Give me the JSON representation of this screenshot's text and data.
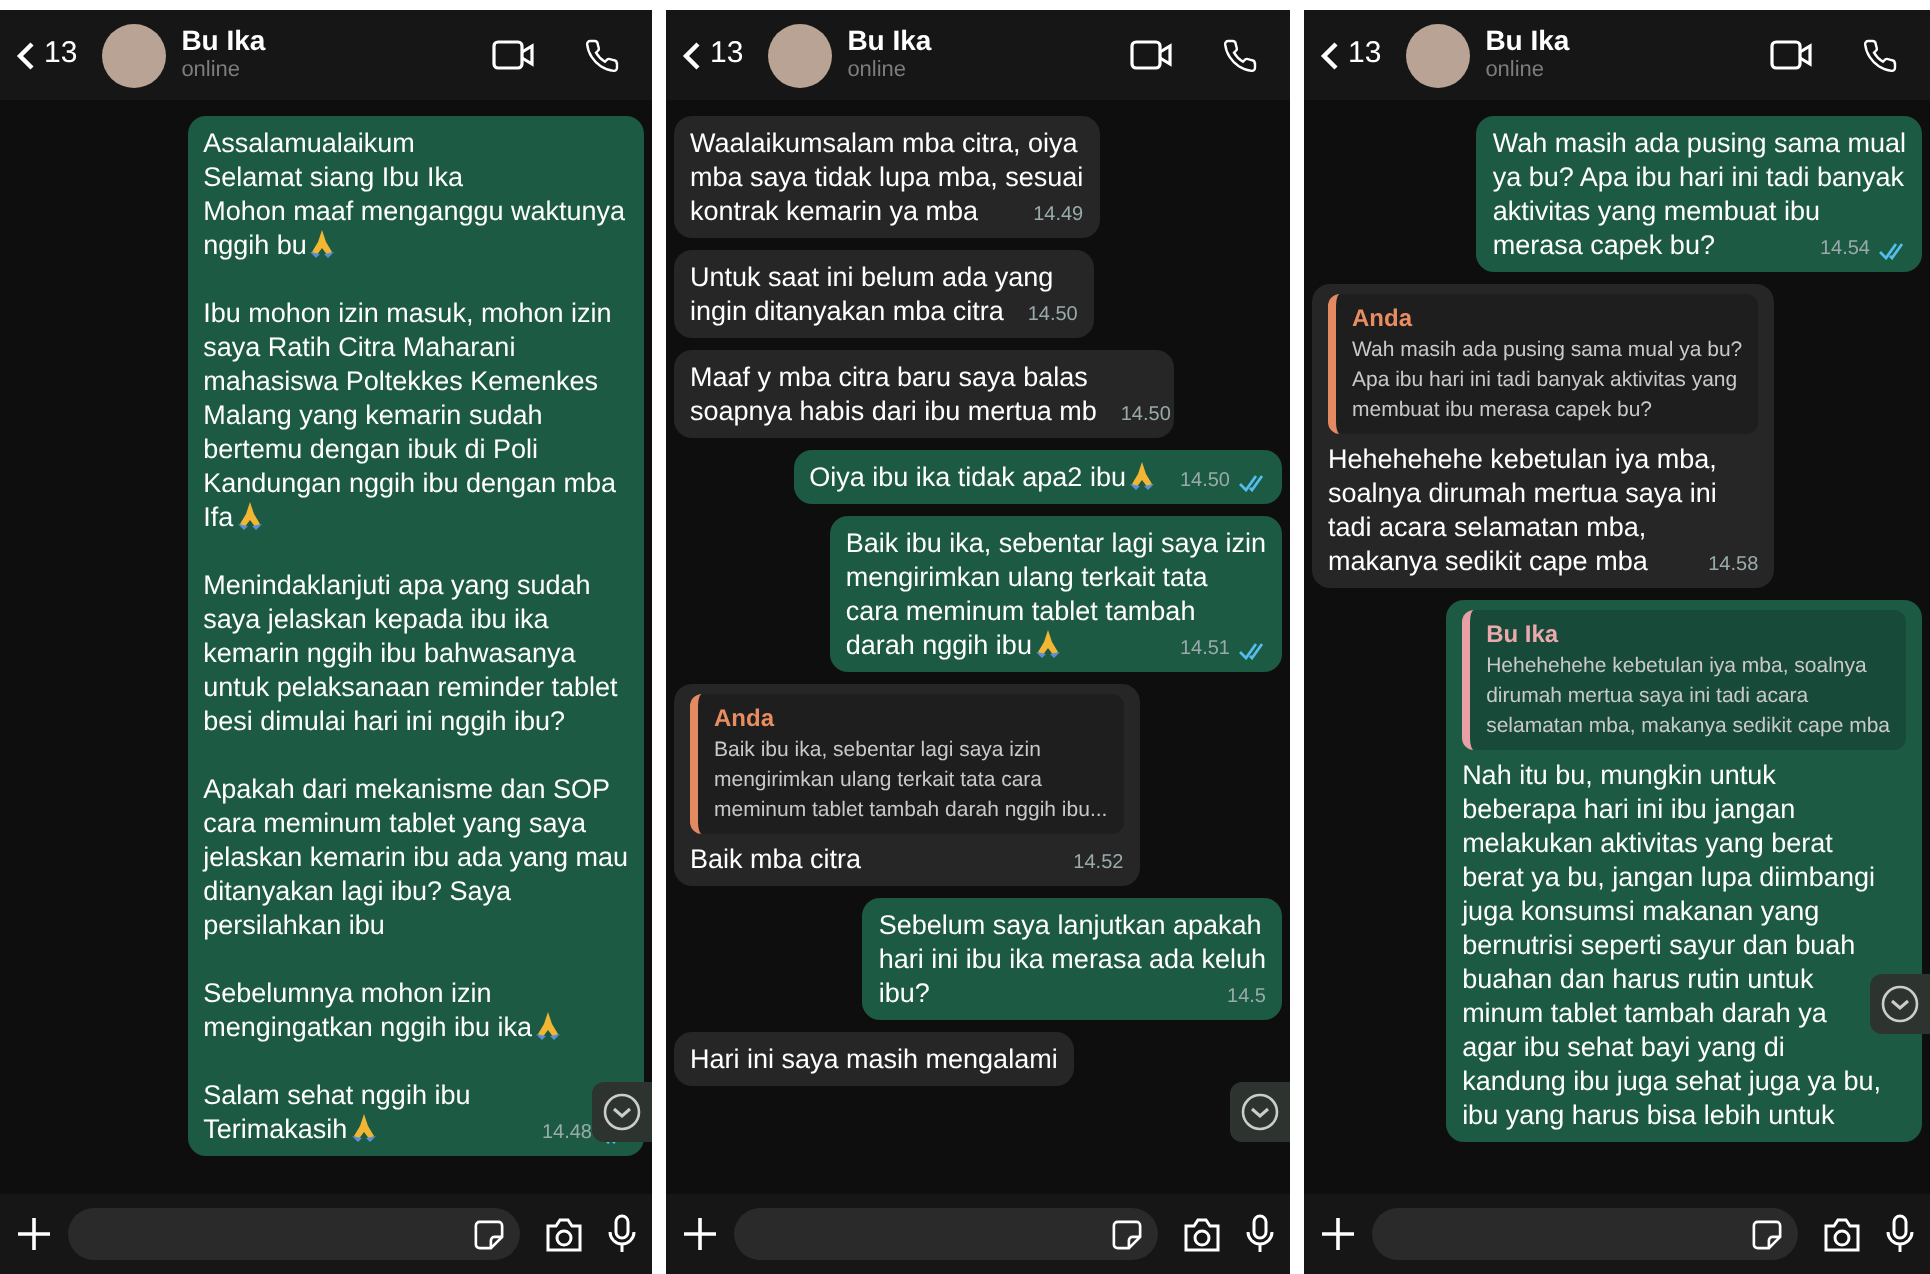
{
  "panels": [
    {
      "header": {
        "back_count": "13",
        "name": "Bu Ika",
        "status": "online"
      },
      "messages": [
        {
          "kind": "outgoing",
          "paragraphs": [
            [
              {
                "text": "Assalamualaikum"
              },
              {
                "text": "Selamat siang Ibu Ika"
              },
              {
                "text": "Mohon maaf menganggu waktunya"
              },
              {
                "text": "nggih bu",
                "pray": true
              }
            ],
            [
              {
                "text": "Ibu mohon izin masuk, mohon izin"
              },
              {
                "text": "saya Ratih Citra Maharani"
              },
              {
                "text": "mahasiswa Poltekkes Kemenkes"
              },
              {
                "text": "Malang yang kemarin sudah"
              },
              {
                "text": "bertemu dengan ibuk di Poli"
              },
              {
                "text": "Kandungan nggih ibu dengan mba"
              },
              {
                "text": "Ifa",
                "pray": true
              }
            ],
            [
              {
                "text": "Menindaklanjuti apa yang sudah"
              },
              {
                "text": "saya jelaskan kepada ibu ika"
              },
              {
                "text": "kemarin nggih ibu bahwasanya"
              },
              {
                "text": "untuk pelaksanaan reminder tablet"
              },
              {
                "text": "besi dimulai hari ini nggih ibu?"
              }
            ],
            [
              {
                "text": "Apakah dari mekanisme dan SOP"
              },
              {
                "text": "cara meminum tablet yang saya"
              },
              {
                "text": "jelaskan kemarin ibu ada yang mau"
              },
              {
                "text": "ditanyakan lagi ibu? Saya"
              },
              {
                "text": "persilahkan ibu"
              }
            ],
            [
              {
                "text": "Sebelumnya mohon izin"
              },
              {
                "text": "mengingatkan nggih ibu ika",
                "pray": true
              }
            ],
            [
              {
                "text": "Salam sehat nggih ibu"
              },
              {
                "text": "Terimakasih",
                "pray": true
              }
            ]
          ],
          "time": "14.48",
          "read": true
        }
      ]
    },
    {
      "header": {
        "back_count": "13",
        "name": "Bu Ika",
        "status": "online"
      },
      "messages": [
        {
          "kind": "incoming",
          "paragraphs": [
            [
              {
                "text": "Waalaikumsalam mba citra, oiya"
              },
              {
                "text": "mba saya tidak lupa mba, sesuai"
              },
              {
                "text": "kontrak kemarin ya mba"
              }
            ]
          ],
          "time": "14.49"
        },
        {
          "kind": "incoming",
          "paragraphs": [
            [
              {
                "text": "Untuk saat ini belum ada yang"
              },
              {
                "text": "ingin ditanyakan mba citra"
              }
            ]
          ],
          "time": "14.50"
        },
        {
          "kind": "incoming",
          "paragraphs": [
            [
              {
                "text": "Maaf y mba citra baru saya balas"
              },
              {
                "text": "soapnya habis dari ibu mertua mb"
              }
            ]
          ],
          "time": "14.50"
        },
        {
          "kind": "outgoing",
          "paragraphs": [
            [
              {
                "text": "Oiya ibu ika tidak apa2 ibu",
                "pray": true
              }
            ]
          ],
          "time": "14.50",
          "read": true
        },
        {
          "kind": "outgoing",
          "paragraphs": [
            [
              {
                "text": "Baik ibu ika, sebentar lagi saya izin"
              },
              {
                "text": "mengirimkan ulang terkait tata"
              },
              {
                "text": "cara meminum tablet tambah"
              },
              {
                "text": "darah nggih ibu",
                "pray": true
              }
            ]
          ],
          "time": "14.51",
          "read": true
        },
        {
          "kind": "incoming",
          "quote": {
            "author": "Anda",
            "text": "Baik ibu ika, sebentar lagi saya izin\nmengirimkan ulang terkait tata cara\nmeminum tablet tambah darah nggih ibu..."
          },
          "paragraphs": [
            [
              {
                "text": "Baik mba citra"
              }
            ]
          ],
          "time": "14.52"
        },
        {
          "kind": "outgoing",
          "paragraphs": [
            [
              {
                "text": "Sebelum saya lanjutkan apakah"
              },
              {
                "text": "hari ini ibu ika merasa ada keluh"
              },
              {
                "text": "ibu?"
              }
            ]
          ],
          "time": "14.5"
        },
        {
          "kind": "incoming",
          "paragraphs": [
            [
              {
                "text": "Hari ini saya masih mengalami"
              }
            ]
          ]
        }
      ]
    },
    {
      "header": {
        "back_count": "13",
        "name": "Bu Ika",
        "status": "online"
      },
      "messages": [
        {
          "kind": "outgoing",
          "paragraphs": [
            [
              {
                "text": "Wah masih ada pusing sama mual"
              },
              {
                "text": "ya bu? Apa ibu hari ini tadi banyak"
              },
              {
                "text": "aktivitas yang membuat ibu"
              },
              {
                "text": "merasa capek bu?"
              }
            ]
          ],
          "time": "14.54",
          "read": true
        },
        {
          "kind": "incoming",
          "quote": {
            "author": "Anda",
            "text": "Wah masih ada pusing sama mual ya bu?\nApa ibu hari ini tadi banyak aktivitas yang\nmembuat ibu merasa capek bu?"
          },
          "paragraphs": [
            [
              {
                "text": "Hehehehehe kebetulan iya mba,"
              },
              {
                "text": "soalnya dirumah mertua saya ini"
              },
              {
                "text": "tadi acara selamatan mba,"
              },
              {
                "text": "makanya sedikit cape mba"
              }
            ]
          ],
          "time": "14.58"
        },
        {
          "kind": "outgoing",
          "quote": {
            "author": "Bu Ika",
            "text": "Hehehehehe kebetulan iya mba, soalnya\ndirumah mertua saya ini tadi acara\nselamatan mba, makanya sedikit cape mba"
          },
          "paragraphs": [
            [
              {
                "text": "Nah itu bu, mungkin untuk"
              },
              {
                "text": "beberapa hari ini ibu jangan"
              },
              {
                "text": "melakukan aktivitas yang berat"
              },
              {
                "text": "berat ya bu, jangan lupa diimbangi"
              },
              {
                "text": "juga konsumsi makanan yang"
              },
              {
                "text": "bernutrisi seperti sayur dan buah"
              },
              {
                "text": "buahan dan harus rutin untuk"
              },
              {
                "text": "minum tablet tambah darah ya"
              },
              {
                "text": "agar ibu sehat bayi yang di"
              },
              {
                "text": "kandung ibu juga sehat juga ya bu,"
              },
              {
                "text": "ibu yang harus bisa lebih untuk"
              }
            ]
          ]
        }
      ]
    }
  ]
}
